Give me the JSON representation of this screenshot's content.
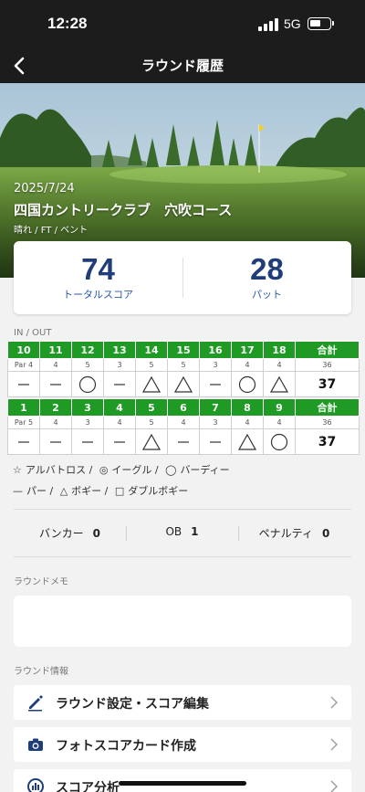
{
  "status_bar": {
    "time": "12:28",
    "network": "5G"
  },
  "nav": {
    "title": "ラウンド履歴"
  },
  "round": {
    "date": "2025/7/24",
    "course": "四国カントリークラブ　穴吹コース",
    "conditions": "晴れ / FT  / ベント"
  },
  "summary": {
    "total_score": "74",
    "total_score_label": "トータルスコア",
    "putts": "28",
    "putts_label": "パット"
  },
  "scorecard": {
    "section_label": "IN / OUT",
    "total_label": "合計",
    "in": {
      "par_label": "Par 4",
      "holes": [
        "10",
        "11",
        "12",
        "13",
        "14",
        "15",
        "16",
        "17",
        "18"
      ],
      "pars": [
        "4",
        "5",
        "3",
        "5",
        "5",
        "3",
        "4",
        "4"
      ],
      "par_total": "36",
      "results": [
        "par",
        "par",
        "birdie",
        "par",
        "bogey",
        "bogey",
        "par",
        "birdie",
        "bogey"
      ],
      "score_total": "37"
    },
    "out": {
      "par_label": "Par 5",
      "holes": [
        "1",
        "2",
        "3",
        "4",
        "5",
        "6",
        "7",
        "8",
        "9"
      ],
      "pars": [
        "4",
        "3",
        "4",
        "5",
        "4",
        "3",
        "4",
        "4"
      ],
      "par_total": "36",
      "results": [
        "par",
        "par",
        "par",
        "par",
        "bogey",
        "par",
        "par",
        "bogey",
        "birdie"
      ],
      "score_total": "37"
    }
  },
  "legend": {
    "albatross": "アルバトロス /",
    "eagle": "イーグル /",
    "birdie": "バーディー",
    "par": "パー /",
    "bogey": "ボギー /",
    "double_bogey": "ダブルボギー"
  },
  "stats": {
    "bunker_label": "バンカー",
    "bunker_value": "0",
    "ob_label": "OB",
    "ob_value": "1",
    "penalty_label": "ペナルティ",
    "penalty_value": "0"
  },
  "memo": {
    "label": "ラウンドメモ"
  },
  "info": {
    "label": "ラウンド情報",
    "items": [
      {
        "label": "ラウンド設定・スコア編集",
        "icon": "pencil-icon"
      },
      {
        "label": "フォトスコアカード作成",
        "icon": "camera-icon"
      },
      {
        "label": "スコア分析",
        "icon": "chart-icon"
      }
    ]
  },
  "colors": {
    "accent_green": "#1e9a25",
    "navy": "#1f3d7a",
    "blue_label": "#2a5aa8",
    "dark_bar": "#1c1c1c"
  }
}
